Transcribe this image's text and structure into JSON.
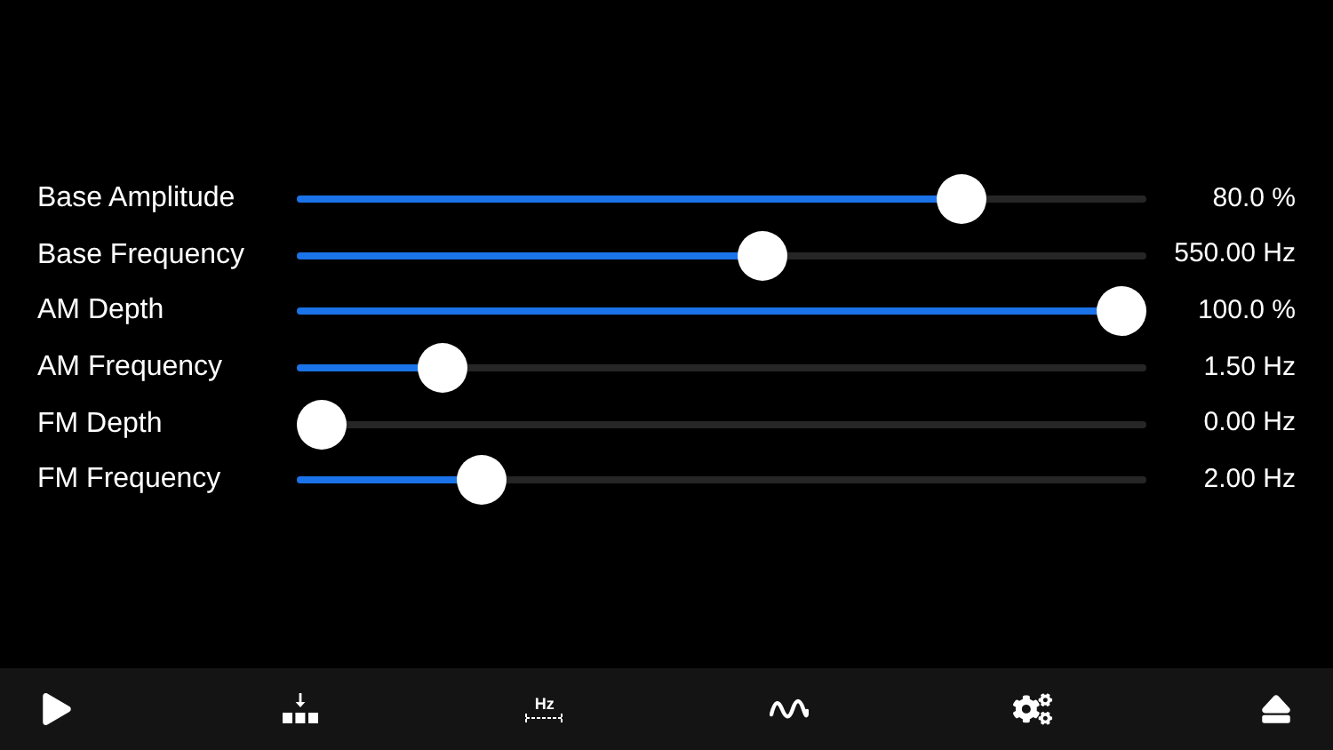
{
  "sliders": [
    {
      "label": "Base Amplitude",
      "level": 0.8,
      "reading": "80.0 %"
    },
    {
      "label": "Base Frequency",
      "level": 0.55,
      "reading": "550.00 Hz"
    },
    {
      "label": "AM Depth",
      "level": 1.0,
      "reading": "100.0 %"
    },
    {
      "label": "AM Frequency",
      "level": 0.15,
      "reading": "1.50 Hz"
    },
    {
      "label": "FM Depth",
      "level": 0.0,
      "reading": "0.00 Hz"
    },
    {
      "label": "FM Frequency",
      "level": 0.2,
      "reading": "2.00 Hz"
    }
  ],
  "toolbar": [
    {
      "kind": "play"
    },
    {
      "kind": "download"
    },
    {
      "kind": "hz",
      "label": "Hz"
    },
    {
      "kind": "wave"
    },
    {
      "kind": "gears"
    },
    {
      "kind": "eject"
    }
  ]
}
